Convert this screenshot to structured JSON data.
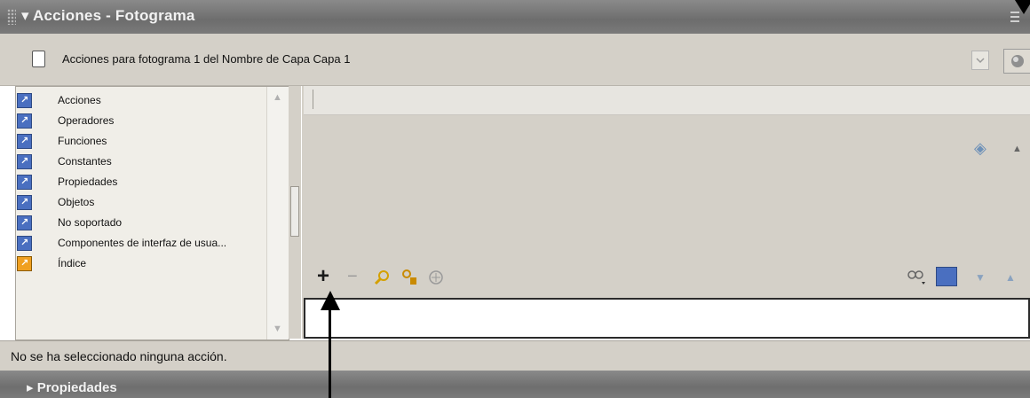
{
  "panel": {
    "title": "Acciones - Fotograma",
    "title_prefix_icon": "triangle-down-icon",
    "menu_icon": "panel-options-icon"
  },
  "header": {
    "script_target": "Acciones para fotograma 1 del Nombre de Capa Capa 1",
    "icon": "script-document-icon"
  },
  "toolbox": {
    "items": [
      {
        "label": "Acciones",
        "icon": "book-icon"
      },
      {
        "label": "Operadores",
        "icon": "book-icon"
      },
      {
        "label": "Funciones",
        "icon": "book-icon"
      },
      {
        "label": "Constantes",
        "icon": "book-icon"
      },
      {
        "label": "Propiedades",
        "icon": "book-icon"
      },
      {
        "label": "Objetos",
        "icon": "book-icon"
      },
      {
        "label": "No soportado",
        "icon": "book-icon"
      },
      {
        "label": "Componentes de interfaz de usua...",
        "icon": "book-icon"
      },
      {
        "label": "Índice",
        "icon": "index-book-icon"
      }
    ]
  },
  "toolbar": {
    "add": "+",
    "remove": "−"
  },
  "status": {
    "text": "No se ha seleccionado ninguna acción."
  },
  "properties_panel": {
    "title": "Propiedades",
    "icon": "triangle-right-icon"
  },
  "colors": {
    "titlebar": "#7a7a7a",
    "panel_bg": "#d4d0c8",
    "book_icon": "#4a6fc0",
    "index_icon": "#f0a020"
  }
}
